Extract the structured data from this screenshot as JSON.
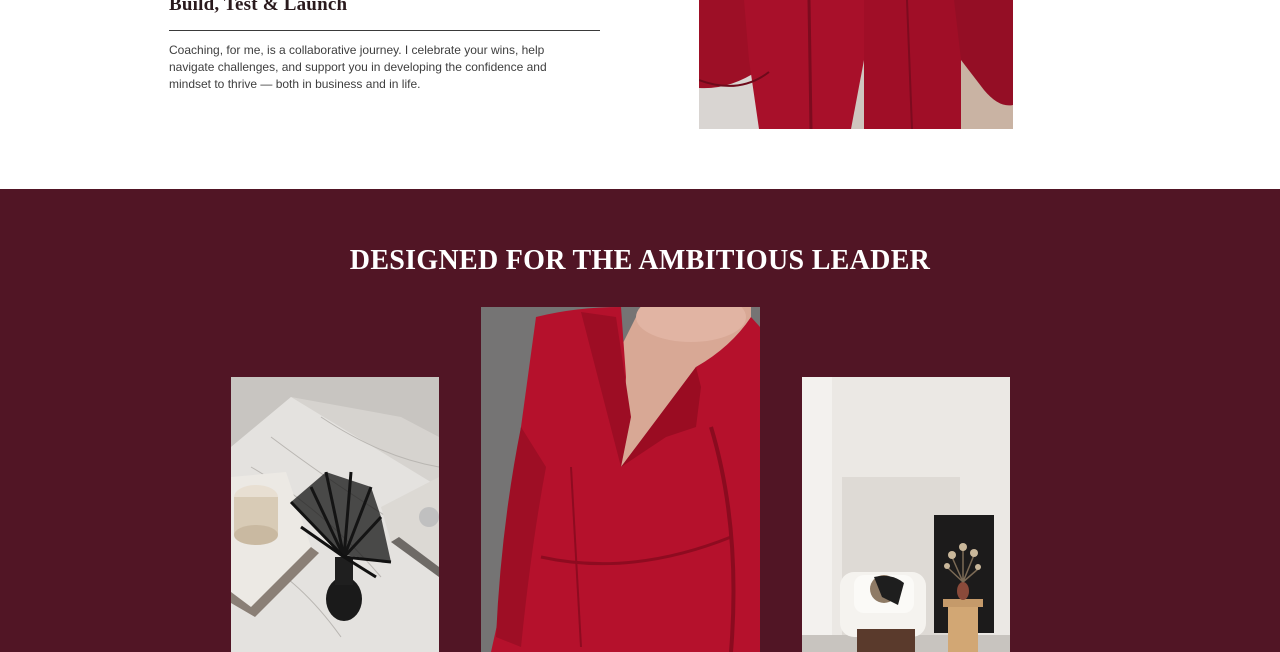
{
  "intro": {
    "heading": "Build, Test & Launch",
    "body": "Coaching, for me, is a collaborative journey. I celebrate your wins, help navigate challenges, and support you in developing the confidence and mindset to thrive — both in business and in life."
  },
  "leader_section": {
    "title": "DESIGNED FOR THE AMBITIOUS LEADER"
  },
  "colors": {
    "section_background": "#511525",
    "accent_red": "#b5112c",
    "heading_text": "#2a1a1d",
    "body_text": "#3e3e3e"
  }
}
